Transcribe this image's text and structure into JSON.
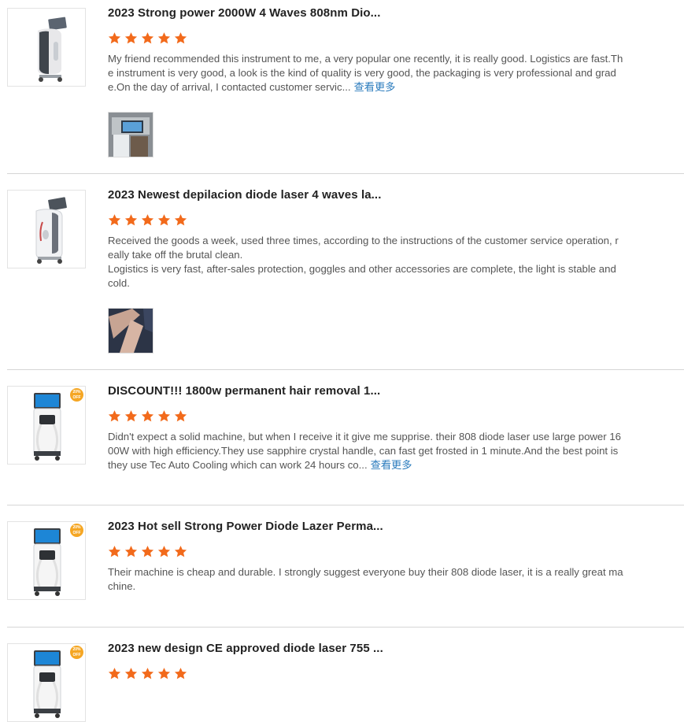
{
  "more_label": "查看更多",
  "star_color": "#f26a1b",
  "reviews": [
    {
      "title": "2023 Strong power 2000W 4 Waves 808nm Dio...",
      "rating": 5,
      "text": "My friend recommended this instrument to me, a very popular one recently, it is really good. Logistics are fast.The instrument is very good, a look is the kind of quality is very good, the packaging is very professional and grade.On the day of arrival, I contacted customer servic...",
      "product_icon": "laser-machine-dark-icon",
      "photo_icon": "customer-photo-machine"
    },
    {
      "title": "2023 Newest depilacion diode laser 4 waves la...",
      "rating": 5,
      "text_lines": [
        "Received the goods a week, used three times, according to the instructions of the customer service operation, really take off the brutal clean.",
        "Logistics is very fast, after-sales protection, goggles and other accessories are complete, the light is stable and cold."
      ],
      "product_icon": "laser-machine-white-icon",
      "photo_icon": "customer-photo-legs"
    },
    {
      "title": "DISCOUNT!!! 1800w permanent hair removal 1...",
      "rating": 5,
      "text": "Didn't expect a solid machine, but when I receive it it give me supprise. their 808 diode laser use large power 1600W with high efficiency.They use sapphire crystal handle, can fast get frosted in 1 minute.And the best point is they use Tec Auto Cooling which can work 24 hours co...",
      "product_icon": "laser-machine-discount-icon",
      "badge": "20% OFF"
    },
    {
      "title": "2023 Hot sell Strong Power Diode Lazer Perma...",
      "rating": 5,
      "text": "Their machine is cheap and durable. I strongly suggest everyone buy their 808 diode laser, it is a really great machine.",
      "product_icon": "laser-machine-discount-icon",
      "badge": "20% OFF"
    },
    {
      "title": "2023 new design CE approved diode laser 755 ...",
      "rating": 5,
      "product_icon": "laser-machine-discount-icon",
      "badge": "20% OFF"
    }
  ]
}
